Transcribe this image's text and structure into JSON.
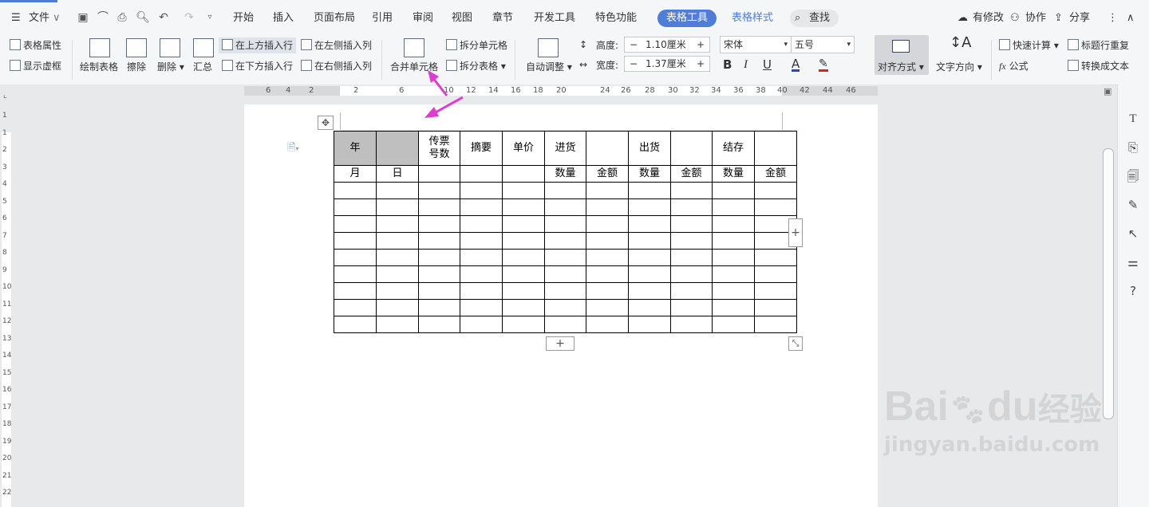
{
  "menubar": {
    "file": "文件",
    "tabs": [
      "开始",
      "插入",
      "页面布局",
      "引用",
      "审阅",
      "视图",
      "章节",
      "开发工具",
      "特色功能"
    ],
    "active_tab": "表格工具",
    "style_tab": "表格样式",
    "search": "查找",
    "modified": "有修改",
    "collab": "协作",
    "share": "分享"
  },
  "ribbon": {
    "table_props": "表格属性",
    "show_gridlines": "显示虚框",
    "draw_table": "绘制表格",
    "erase": "擦除",
    "delete": "删除",
    "summary": "汇总",
    "insert_above": "在上方插入行",
    "insert_below": "在下方插入行",
    "insert_left": "在左侧插入列",
    "insert_right": "在右侧插入列",
    "merge_cells": "合并单元格",
    "split_cells": "拆分单元格",
    "split_table": "拆分表格",
    "auto_fit": "自动调整",
    "height_label": "高度:",
    "height_value": "1.10厘米",
    "width_label": "宽度:",
    "width_value": "1.37厘米",
    "font_name": "宋体",
    "font_size": "五号",
    "align": "对齐方式",
    "text_direction": "文字方向",
    "quick_calc": "快速计算",
    "repeat_header": "标题行重复",
    "formula": "公式",
    "to_text": "转换成文本",
    "bold": "B",
    "italic": "I",
    "underline": "U",
    "font_color_glyph": "A"
  },
  "ruler_ticks": [
    "6",
    "4",
    "2",
    "2",
    "6",
    "10",
    "12",
    "14",
    "16",
    "18",
    "20",
    "24",
    "26",
    "28",
    "30",
    "32",
    "34",
    "36",
    "38",
    "40",
    "42",
    "44",
    "46"
  ],
  "vruler_ticks": [
    "1",
    "1",
    "2",
    "3",
    "4",
    "5",
    "6",
    "7",
    "8",
    "9",
    "10",
    "11",
    "12",
    "13",
    "14",
    "15",
    "16",
    "17",
    "18",
    "19",
    "20",
    "21",
    "22"
  ],
  "table": {
    "header_row1": [
      "年",
      "",
      "传票\n号数",
      "摘要",
      "单价",
      "进货",
      "",
      "出货",
      "",
      "结存",
      ""
    ],
    "header_row2": [
      "月",
      "日",
      "",
      "",
      "",
      "数量",
      "金额",
      "数量",
      "金额",
      "数量",
      "金额"
    ],
    "empty_rows": 9
  },
  "watermark": {
    "brand": "Bai",
    "brand_suffix": "du",
    "brand_cn": "经验",
    "url": "jingyan.baidu.com"
  },
  "colors": {
    "accent": "#4f7dd8",
    "annotation_arrow": "#e03ad0",
    "header_fill": "#bfbfbf"
  }
}
